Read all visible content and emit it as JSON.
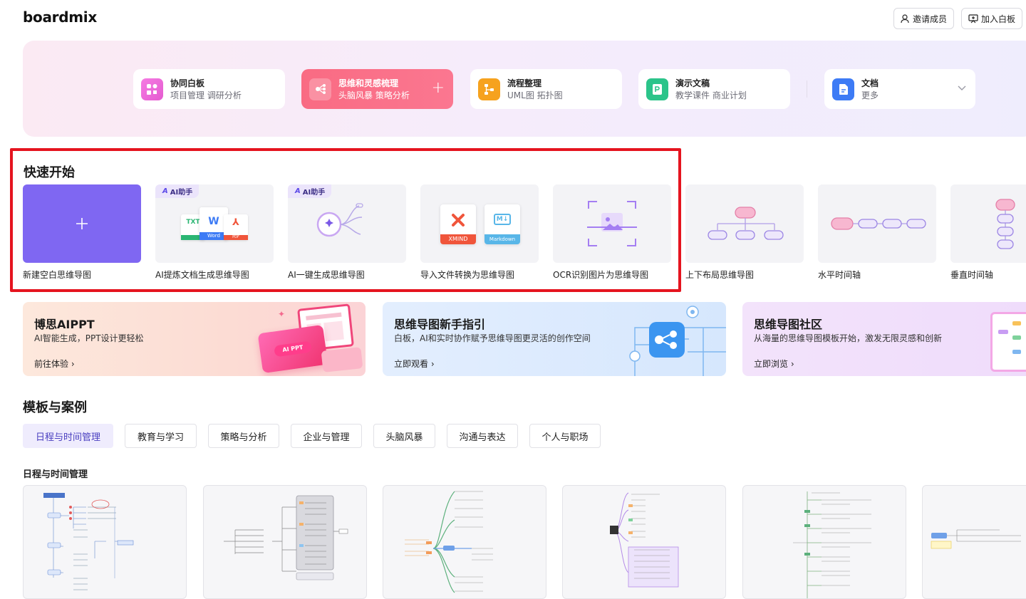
{
  "header": {
    "logo": "boardmix",
    "invite_label": "邀请成员",
    "join_label": "加入白板"
  },
  "categories": [
    {
      "title": "协同白板",
      "subtitle": "项目管理 调研分析",
      "icon": "whiteboard-icon",
      "color": "#f06bd6"
    },
    {
      "title": "思维和灵感梳理",
      "subtitle": "头脑风暴 策略分析",
      "icon": "mindmap-icon",
      "color": "#fb7790"
    },
    {
      "title": "流程整理",
      "subtitle": "UML图 拓扑图",
      "icon": "flowchart-icon",
      "color": "#f6a21e"
    },
    {
      "title": "演示文稿",
      "subtitle": "教学课件 商业计划",
      "icon": "presentation-icon",
      "color": "#2bc48a"
    },
    {
      "title": "文档",
      "subtitle": "更多",
      "icon": "document-icon",
      "color": "#3d7bf5"
    }
  ],
  "quick_start": {
    "title": "快速开始",
    "ai_tag": "AI助手",
    "items": [
      {
        "label": "新建空白思维导图"
      },
      {
        "label": "AI提炼文档生成思维导图",
        "file_tags": [
          "TXT",
          "Word",
          "PDF"
        ]
      },
      {
        "label": "AI一键生成思维导图"
      },
      {
        "label": "导入文件转换为思维导图",
        "file_tags": [
          "XMIND",
          "Markdown"
        ]
      },
      {
        "label": "OCR识别图片为思维导图"
      },
      {
        "label": "上下布局思维导图"
      },
      {
        "label": "水平时间轴"
      },
      {
        "label": "垂直时间轴"
      }
    ]
  },
  "banners": [
    {
      "title": "博思AIPPT",
      "subtitle": "AI智能生成，PPT设计更轻松",
      "link": "前往体验",
      "badge": "AI PPT"
    },
    {
      "title": "思维导图新手指引",
      "subtitle": "白板，AI和实时协作赋予思维导图更灵活的创作空间",
      "link": "立即观看"
    },
    {
      "title": "思维导图社区",
      "subtitle": "从海量的思维导图模板开始，激发无限灵感和创新",
      "link": "立即浏览"
    }
  ],
  "templates": {
    "title": "模板与案例",
    "tabs": [
      "日程与时间管理",
      "教育与学习",
      "策略与分析",
      "企业与管理",
      "头脑风暴",
      "沟通与表达",
      "个人与职场"
    ],
    "active_tab": "日程与时间管理",
    "section_title": "日程与时间管理"
  }
}
